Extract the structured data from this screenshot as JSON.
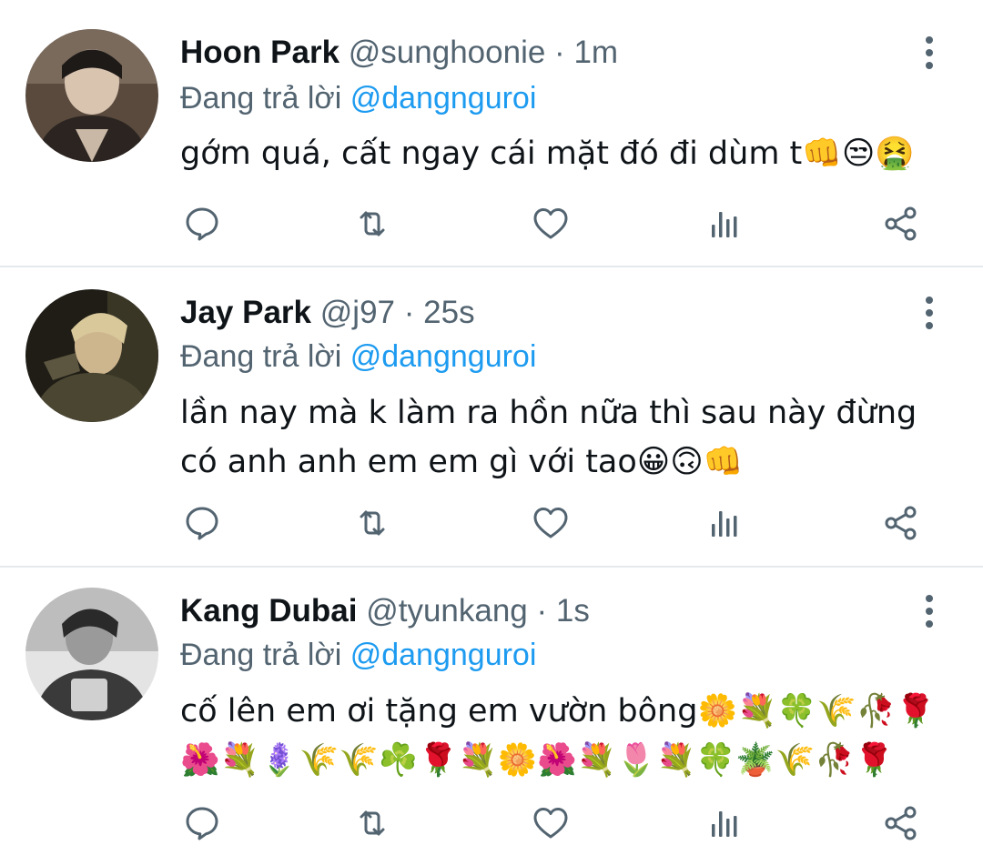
{
  "tweets": [
    {
      "name": "Hoon Park",
      "handle": "@sunghoonie",
      "separator": "·",
      "time": "1m",
      "reply_prefix": "Đang trả lời",
      "reply_handle": "@dangnguroi",
      "lines": [
        "gớm quá, cất ngay cái mặt đó đi dùm t👊😒🤮"
      ],
      "avatar_colors": [
        "#5a4a3e",
        "#2b2420",
        "#c9b8a6"
      ]
    },
    {
      "name": "Jay Park",
      "handle": "@j97",
      "separator": "·",
      "time": "25s",
      "reply_prefix": "Đang trả lời",
      "reply_handle": "@dangnguroi",
      "lines": [
        "lần nay mà k làm ra hồn nữa thì sau này đừng",
        "có anh anh em em gì với tao😀🙃👊"
      ],
      "avatar_colors": [
        "#4a4632",
        "#1f1d16",
        "#d8c89a"
      ]
    },
    {
      "name": "Kang Dubai",
      "handle": "@tyunkang",
      "separator": "·",
      "time": "1s",
      "reply_prefix": "Đang trả lời",
      "reply_handle": "@dangnguroi",
      "lines": [
        "cố lên em ơi tặng em vườn bông🌼💐🍀🌾🥀🌹",
        "🌺💐🪻🌾🌾☘️🌹💐🌼🌺💐🌷💐🍀🪴🌾🥀🌹"
      ],
      "avatar_colors": [
        "#8a8a8a",
        "#2a2a2a",
        "#e4e4e4"
      ]
    }
  ],
  "icons": [
    "reply-icon",
    "retweet-icon",
    "like-icon",
    "views-icon",
    "share-icon",
    "more-options-icon"
  ],
  "colors": {
    "text": "#0f1419",
    "muted": "#536471",
    "link": "#1d9bf0",
    "divider": "#e6e9eb"
  }
}
